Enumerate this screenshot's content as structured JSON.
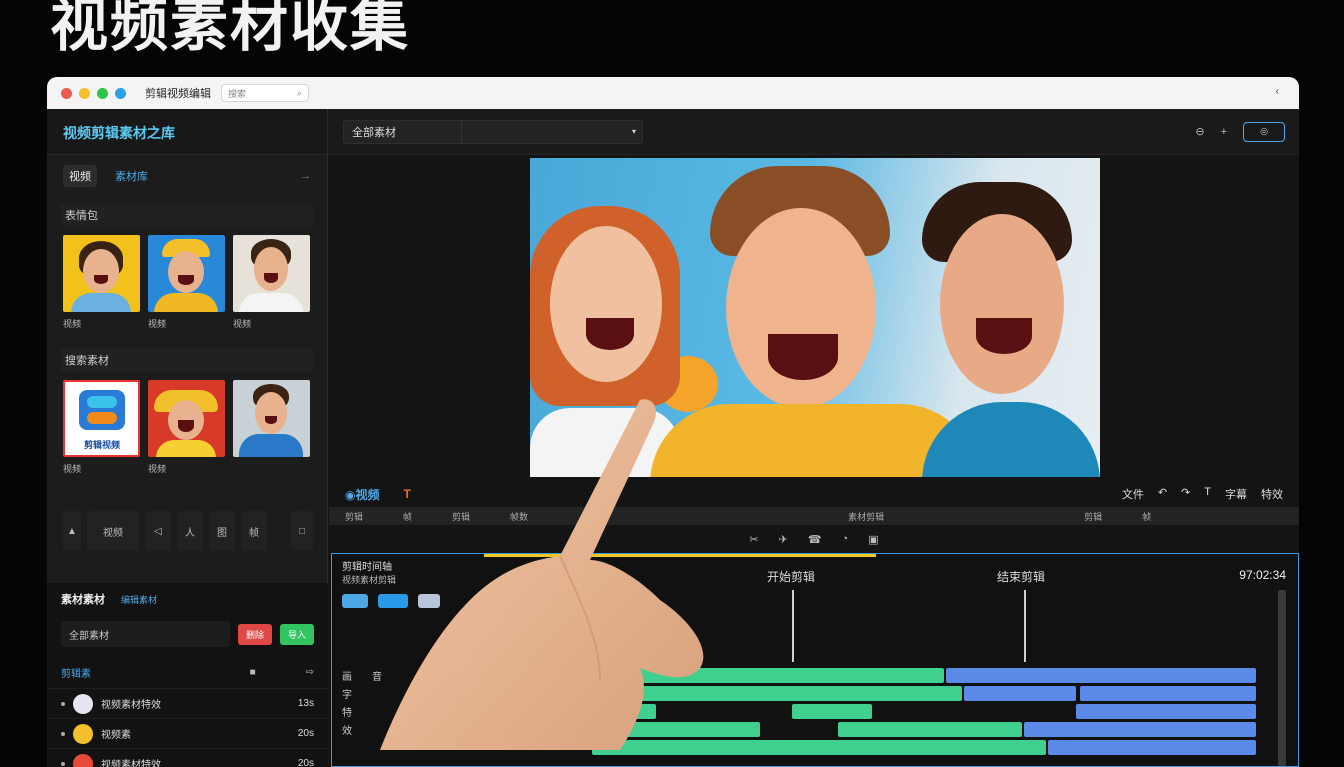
{
  "headline": "视频素材收集",
  "window": {
    "app_title": "剪辑视频编辑",
    "search_value": "搜索",
    "right_symbol": "‹"
  },
  "colors": {
    "accent": "#4ea8e8",
    "track_green": "#3fcf8e",
    "track_blue": "#5b8ae8",
    "progress_yellow": "#f0c820"
  },
  "left": {
    "brand": "视频剪辑素材之库",
    "tabs": [
      "视频",
      "素材库"
    ],
    "tabs_arrow": "→",
    "sections": [
      {
        "title": "表情包",
        "captions": [
          "视频",
          "视频",
          "视频"
        ]
      },
      {
        "title": "搜索素材",
        "captions": [
          "视频",
          "视频"
        ]
      }
    ],
    "logo_text": "剪辑视频",
    "tools": [
      "▲",
      "视频",
      "◁",
      "人",
      "图",
      "帧",
      "□"
    ]
  },
  "library": {
    "title": "素材素材",
    "sub": "编辑素材",
    "filter_label": "全部素材",
    "btn_red": "删除",
    "btn_green": "导入",
    "list_title": "剪辑素",
    "list_icons": [
      "■",
      "⇨"
    ],
    "items": [
      {
        "name": "视频素材特效",
        "size": "13s"
      },
      {
        "name": "视频素",
        "size": "20s"
      },
      {
        "name": "视频素材特效",
        "size": "20s"
      }
    ]
  },
  "main": {
    "select_label": "全部素材",
    "select_caret": "▾",
    "top_icons": [
      "⊖",
      "+"
    ],
    "top_btn": "◎",
    "ctrl_logo": "◉视频",
    "ctrl_fx": "T",
    "ctrl_right": [
      "文件",
      "↶",
      "↷",
      "T",
      "字幕",
      "特效"
    ],
    "ruler": [
      "剪辑",
      "帧",
      "剪辑",
      "帧数",
      "素材剪辑",
      "剪辑",
      "帧"
    ],
    "icons_row": [
      "✂",
      "✈",
      "☎",
      "◔",
      "▣"
    ]
  },
  "timeline": {
    "title": "剪辑时间轴",
    "sub": "视频素材剪辑",
    "marker1": "开始剪辑",
    "marker2": "结束剪辑",
    "time": "97:02:34",
    "track_labels": [
      "画",
      "音",
      "字",
      "特",
      "效"
    ]
  }
}
